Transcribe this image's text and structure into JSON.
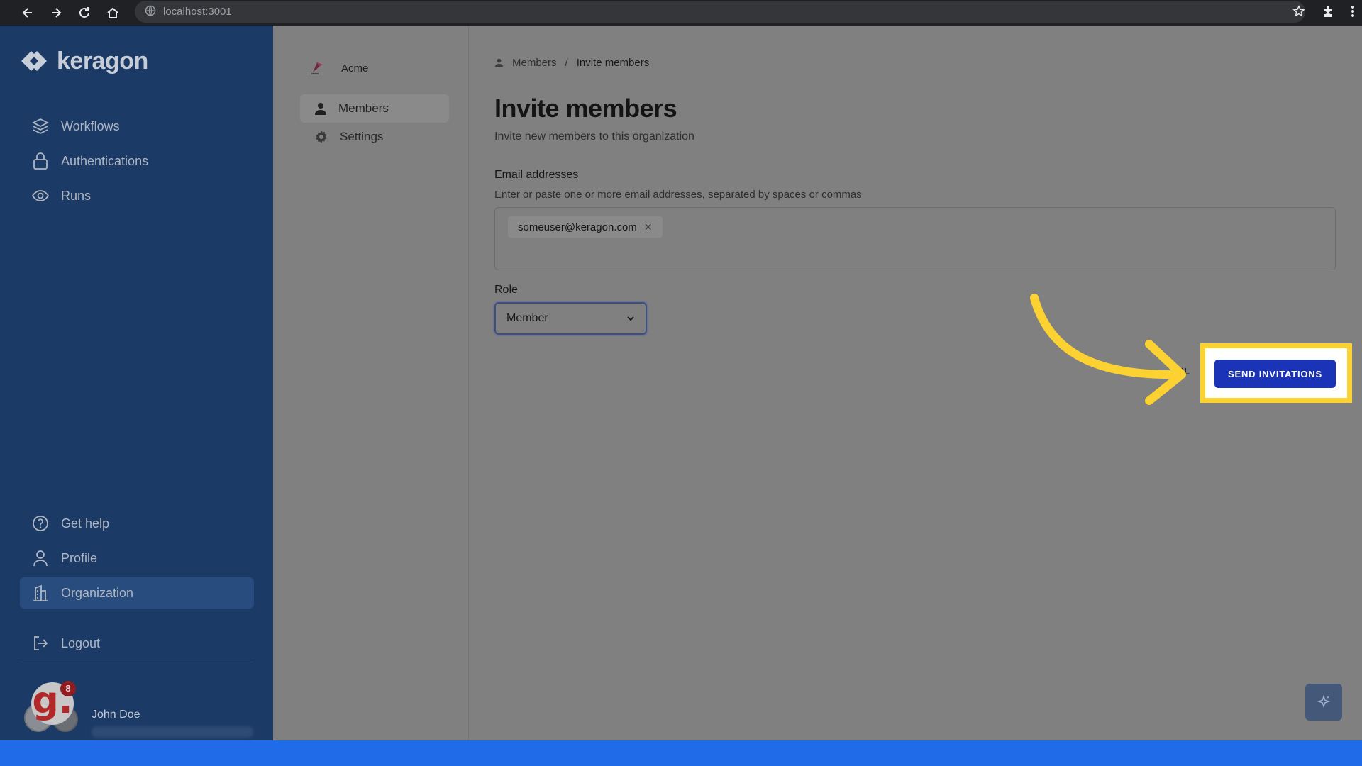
{
  "browser": {
    "url": "localhost:3001"
  },
  "sidebar": {
    "logo_text": "keragon",
    "nav": [
      {
        "label": "Workflows",
        "icon": "layers-icon"
      },
      {
        "label": "Authentications",
        "icon": "lock-icon"
      },
      {
        "label": "Runs",
        "icon": "eye-icon"
      }
    ],
    "bottom": [
      {
        "label": "Get help",
        "icon": "help-circle-icon"
      },
      {
        "label": "Profile",
        "icon": "user-icon"
      },
      {
        "label": "Organization",
        "icon": "building-icon",
        "active": true
      },
      {
        "label": "Logout",
        "icon": "logout-icon"
      }
    ],
    "user": {
      "name": "John Doe",
      "notification_count": "8",
      "avatar_letter": "g."
    }
  },
  "subnav": {
    "org_name": "Acme",
    "items": [
      {
        "label": "Members",
        "icon": "person-icon",
        "active": true
      },
      {
        "label": "Settings",
        "icon": "gear-icon"
      }
    ]
  },
  "main": {
    "breadcrumb": {
      "parent": "Members",
      "separator": "/",
      "current": "Invite members"
    },
    "title": "Invite members",
    "subtitle": "Invite new members to this organization",
    "email_label": "Email addresses",
    "email_hint": "Enter or paste one or more email addresses, separated by spaces or commas",
    "email_chips": [
      "someuser@keragon.com"
    ],
    "role_label": "Role",
    "role_value": "Member",
    "cancel_label": "EL",
    "send_label": "SEND INVITATIONS"
  },
  "colors": {
    "sidebar_bg": "#1c3a66",
    "send_button": "#1b33b6",
    "highlight": "#fbd232"
  }
}
